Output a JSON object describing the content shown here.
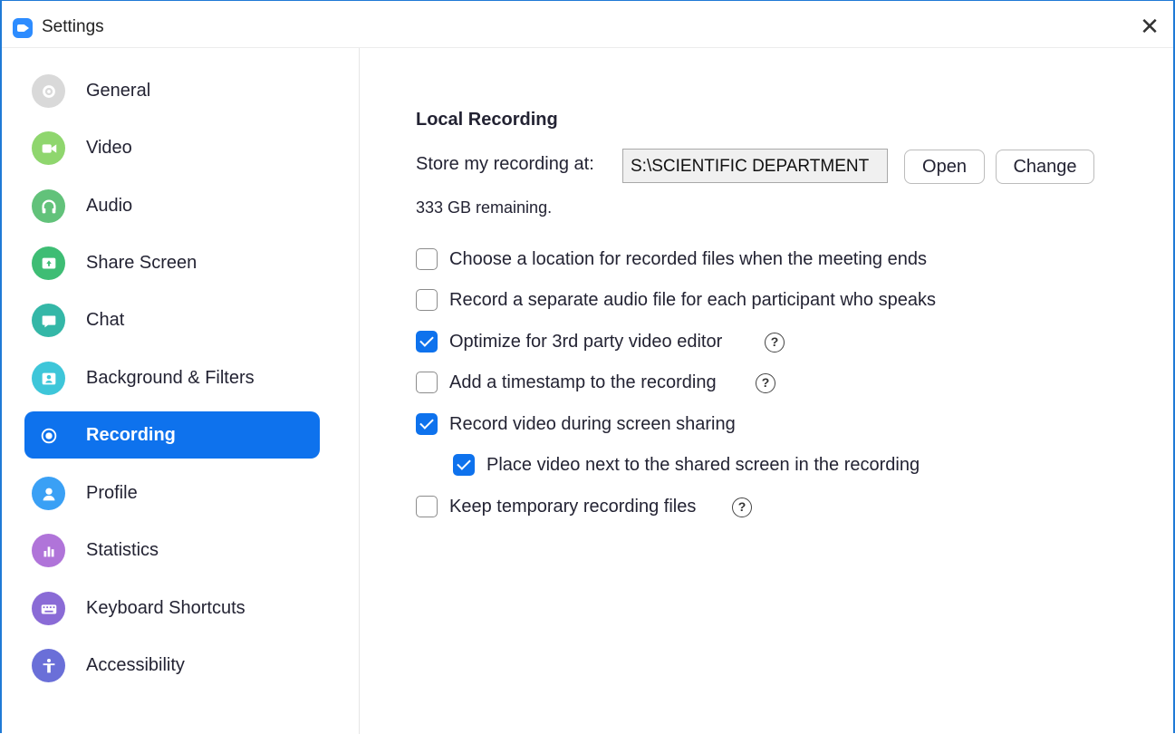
{
  "window": {
    "title": "Settings",
    "close_glyph": "✕"
  },
  "sidebar": {
    "items": [
      {
        "label": "General",
        "icon": "gear-icon",
        "color": "#d9d9d9"
      },
      {
        "label": "Video",
        "icon": "video-camera-icon",
        "color": "#8fd66e"
      },
      {
        "label": "Audio",
        "icon": "headphones-icon",
        "color": "#62c27a"
      },
      {
        "label": "Share Screen",
        "icon": "share-screen-icon",
        "color": "#3ebd74"
      },
      {
        "label": "Chat",
        "icon": "chat-bubble-icon",
        "color": "#34b7a7"
      },
      {
        "label": "Background & Filters",
        "icon": "background-person-icon",
        "color": "#3ec6d9"
      },
      {
        "label": "Recording",
        "icon": "record-icon",
        "color": "#0e72ed",
        "active": true
      },
      {
        "label": "Profile",
        "icon": "profile-icon",
        "color": "#3aa0f5"
      },
      {
        "label": "Statistics",
        "icon": "bar-chart-icon",
        "color": "#b074d9"
      },
      {
        "label": "Keyboard Shortcuts",
        "icon": "keyboard-icon",
        "color": "#8a6bd6"
      },
      {
        "label": "Accessibility",
        "icon": "accessibility-icon",
        "color": "#6a6fd8"
      }
    ]
  },
  "recording": {
    "section_title": "Local Recording",
    "store_label": "Store my recording at:",
    "path_value": "S:\\SCIENTIFIC DEPARTMENT",
    "open_label": "Open",
    "change_label": "Change",
    "remaining": "333 GB remaining.",
    "options": [
      {
        "label": "Choose a location for recorded files when the meeting ends",
        "checked": false,
        "help": false
      },
      {
        "label": "Record a separate audio file for each participant who speaks",
        "checked": false,
        "help": false
      },
      {
        "label": "Optimize for 3rd party video editor",
        "checked": true,
        "help": true
      },
      {
        "label": "Add a timestamp to the recording",
        "checked": false,
        "help": true
      },
      {
        "label": "Record video during screen sharing",
        "checked": true,
        "help": false
      },
      {
        "label": "Place video next to the shared screen in the recording",
        "checked": true,
        "help": false
      },
      {
        "label": "Keep temporary recording files",
        "checked": false,
        "help": true
      }
    ],
    "help_glyph": "?"
  },
  "colors": {
    "accent": "#0e72ed",
    "window_border": "#1f7ad6"
  }
}
